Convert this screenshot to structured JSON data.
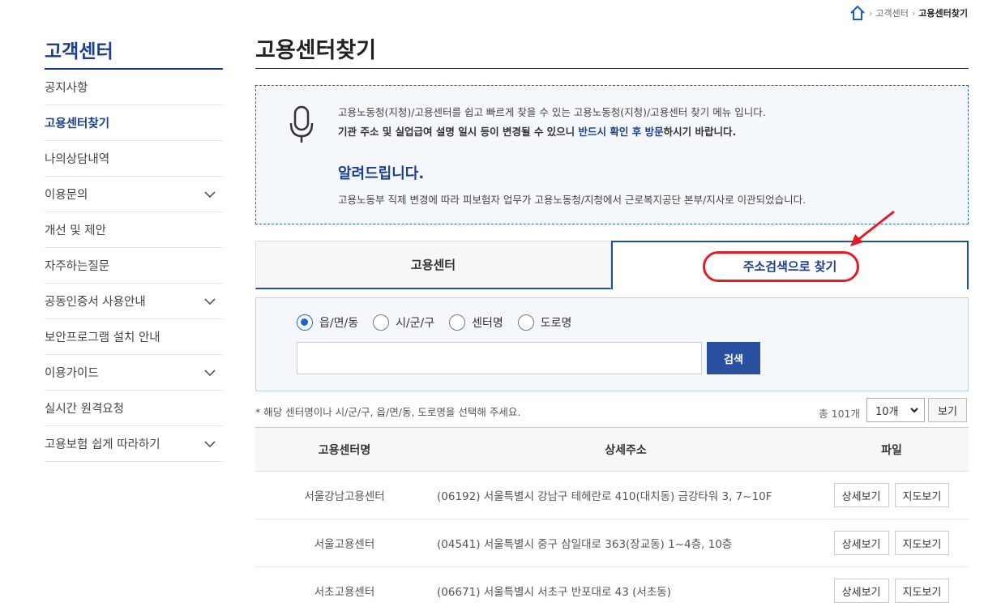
{
  "breadcrumb": {
    "home_icon": "home-icon",
    "level1": "고객센터",
    "current": "고용센터찾기"
  },
  "sidebar": {
    "title": "고객센터",
    "items": [
      {
        "label": "공지사항",
        "active": false,
        "has_chevron": false
      },
      {
        "label": "고용센터찾기",
        "active": true,
        "has_chevron": false
      },
      {
        "label": "나의상담내역",
        "active": false,
        "has_chevron": false
      },
      {
        "label": "이용문의",
        "active": false,
        "has_chevron": true
      },
      {
        "label": "개선 및 제안",
        "active": false,
        "has_chevron": false
      },
      {
        "label": "자주하는질문",
        "active": false,
        "has_chevron": false
      },
      {
        "label": "공동인증서 사용안내",
        "active": false,
        "has_chevron": true
      },
      {
        "label": "보안프로그램 설치 안내",
        "active": false,
        "has_chevron": false
      },
      {
        "label": "이용가이드",
        "active": false,
        "has_chevron": true
      },
      {
        "label": "실시간 원격요청",
        "active": false,
        "has_chevron": false
      },
      {
        "label": "고용보험 쉽게 따라하기",
        "active": false,
        "has_chevron": true
      }
    ]
  },
  "main": {
    "title": "고용센터찾기",
    "notice": {
      "line1": "고용노동청(지청)/고용센터를 쉽고 빠르게 찾을 수 있는 고용노동청(지청)/고용센터 찾기 메뉴 입니다.",
      "line2_a": "기관 주소 및 실업급여 설명 일시 등이 변경될 수 있으니 ",
      "line2_hl": "반드시 확인 후 방문",
      "line2_b": "하시기 바랍니다.",
      "heading": "알려드립니다.",
      "sub": "고용노동부 직제 변경에 따라 피보험자 업무가 고용노동청/지청에서 근로복지공단 본부/지사로 이관되었습니다."
    },
    "tabs": [
      {
        "label": "고용센터",
        "active": false
      },
      {
        "label": "주소검색으로 찾기",
        "active": true
      }
    ],
    "search": {
      "options": [
        {
          "label": "읍/면/동",
          "checked": true
        },
        {
          "label": "시/군/구",
          "checked": false
        },
        {
          "label": "센터명",
          "checked": false
        },
        {
          "label": "도로명",
          "checked": false
        }
      ],
      "input_value": "",
      "button": "검색"
    },
    "results": {
      "hint": "* 해당 센터명이나 시/군/구, 읍/면/동, 도로명을 선택해 주세요.",
      "total": "총 101개",
      "page_size": "10개",
      "view_button": "보기"
    },
    "table": {
      "headers": [
        "고용센터명",
        "상세주소",
        "파일"
      ],
      "rows": [
        {
          "name": "서울강남고용센터",
          "address": "(06192) 서울특별시 강남구 테헤란로 410(대치동) 금강타워 3, 7~10F",
          "btn1": "상세보기",
          "btn2": "지도보기"
        },
        {
          "name": "서울고용센터",
          "address": "(04541) 서울특별시 중구 삼일대로 363(장교동) 1~4층, 10층",
          "btn1": "상세보기",
          "btn2": "지도보기"
        },
        {
          "name": "서초고용센터",
          "address": "(06671) 서울특별시 서초구 반포대로 43 (서초동)",
          "btn1": "상세보기",
          "btn2": "지도보기"
        }
      ]
    }
  },
  "colors": {
    "brand": "#1d3f8f",
    "highlight": "#e51b23",
    "radio": "#1c65d5",
    "button": "#2a4f9f"
  }
}
